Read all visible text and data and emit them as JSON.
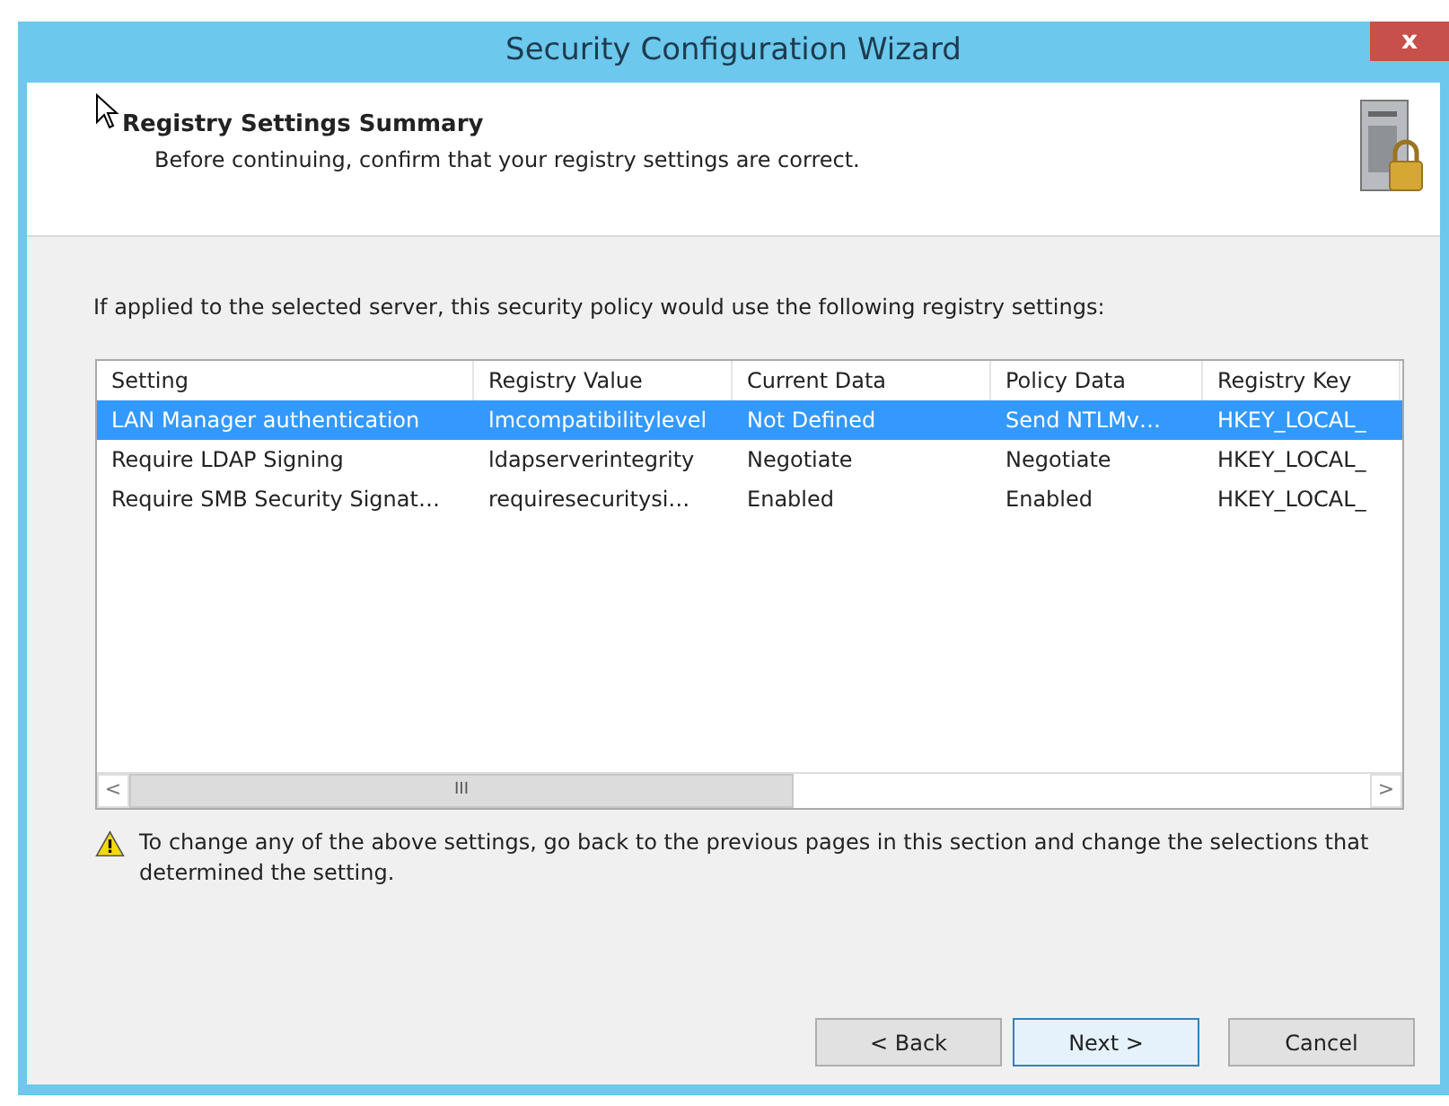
{
  "window": {
    "title": "Security Configuration Wizard",
    "close": "x"
  },
  "header": {
    "title": "Registry Settings Summary",
    "subtitle": "Before continuing, confirm that your registry settings are correct."
  },
  "intro": "If applied to the selected server, this security policy would use the following registry settings:",
  "table": {
    "columns": [
      "Setting",
      "Registry Value",
      "Current Data",
      "Policy Data",
      "Registry Key"
    ],
    "rows": [
      {
        "selected": true,
        "cells": [
          "LAN Manager authentication",
          "lmcompatibilitylevel",
          "Not Defined",
          "Send NTLMv…",
          "HKEY_LOCAL_"
        ]
      },
      {
        "selected": false,
        "cells": [
          "Require LDAP Signing",
          "ldapserverintegrity",
          "Negotiate",
          "Negotiate",
          "HKEY_LOCAL_"
        ]
      },
      {
        "selected": false,
        "cells": [
          "Require SMB Security Signat…",
          "requiresecuritysi…",
          "Enabled",
          "Enabled",
          "HKEY_LOCAL_"
        ]
      }
    ],
    "scrollbar": {
      "left": "<",
      "grip": "III",
      "right": ">"
    }
  },
  "warning": "To change any of the above settings, go back to the previous pages in this section and change the selections that determined the setting.",
  "buttons": [
    {
      "label": "< Back",
      "focused": false
    },
    {
      "label": "Next >",
      "focused": true
    },
    {
      "label": "Cancel",
      "focused": false
    }
  ]
}
